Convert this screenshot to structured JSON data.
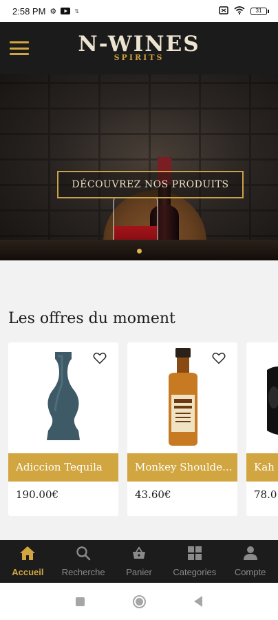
{
  "status_bar": {
    "time": "2:58 PM",
    "left_icons": [
      "settings-icon",
      "youtube-icon",
      "data-icon"
    ],
    "right_icons": [
      "screenshot-icon",
      "wifi-icon",
      "battery-icon"
    ],
    "battery_level": "31"
  },
  "header": {
    "menu_icon": "hamburger-menu-icon",
    "logo_title": "N-WINES",
    "logo_subtitle": "SPIRITS"
  },
  "hero": {
    "cta_label": "DÉCOUVREZ NOS PRODUITS",
    "slide_count": 1,
    "active_slide": 1
  },
  "offers": {
    "title": "Les offres du moment",
    "products": [
      {
        "name": "Adiccion Tequila",
        "price": "190.00€",
        "image": "blue-ceramic-bottle",
        "favorite": false
      },
      {
        "name": "Monkey Shoulde...",
        "price": "43.60€",
        "image": "whisky-bottle",
        "favorite": false
      },
      {
        "name": "Kah",
        "price": "78.0",
        "image": "black-skull-bottle",
        "favorite": false
      }
    ]
  },
  "bottom_nav": {
    "items": [
      {
        "label": "Accueil",
        "icon": "home-icon",
        "active": true
      },
      {
        "label": "Recherche",
        "icon": "search-icon",
        "active": false
      },
      {
        "label": "Panier",
        "icon": "basket-icon",
        "active": false
      },
      {
        "label": "Categories",
        "icon": "grid-icon",
        "active": false
      },
      {
        "label": "Compte",
        "icon": "user-icon",
        "active": false
      }
    ]
  },
  "colors": {
    "accent_gold": "#d1a640",
    "header_bg": "#1b1b1b",
    "nav_inactive": "#8a8a8a"
  }
}
